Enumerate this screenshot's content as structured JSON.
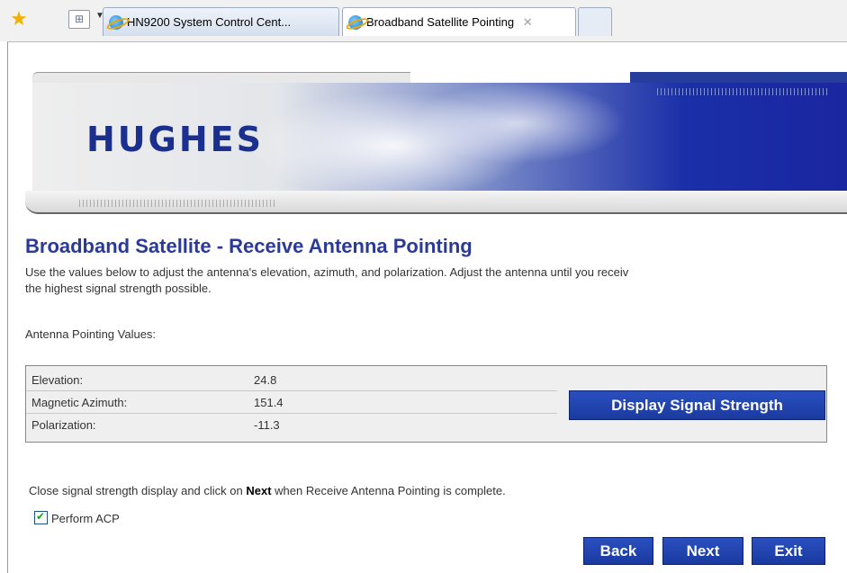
{
  "browser": {
    "tabs": [
      {
        "label": "HN9200 System Control Cent...",
        "active": false
      },
      {
        "label": "Broadband Satellite Pointing",
        "active": true
      }
    ],
    "tab_close_glyph": "✕",
    "icons": {
      "favorites": "star-icon",
      "quick_tabs": "quick-tabs-icon",
      "tab_list": "chevron-down-icon",
      "ie": "ie-icon"
    }
  },
  "banner": {
    "logo_text": "HUGHES"
  },
  "page": {
    "title": "Broadband Satellite - Receive Antenna Pointing",
    "intro_line1": "Use the values below to adjust the antenna's elevation, azimuth, and polarization.  Adjust the antenna until you receiv",
    "intro_line2": "the highest signal strength possible.",
    "values_label": "Antenna Pointing Values:",
    "values": [
      {
        "label": "Elevation:",
        "value": "24.8"
      },
      {
        "label": "Magnetic Azimuth:",
        "value": "151.4"
      },
      {
        "label": "Polarization:",
        "value": "-11.3"
      }
    ],
    "display_signal_button": "Display Signal Strength",
    "close_text_before": "Close signal strength display and click on ",
    "close_text_bold": "Next",
    "close_text_after": " when Receive Antenna Pointing is complete.",
    "acp_label": "Perform ACP",
    "acp_checked": true,
    "buttons": {
      "back": "Back",
      "next": "Next",
      "exit": "Exit"
    }
  },
  "colors": {
    "accent_blue": "#1a3aa0",
    "title_blue": "#2b3a98"
  }
}
